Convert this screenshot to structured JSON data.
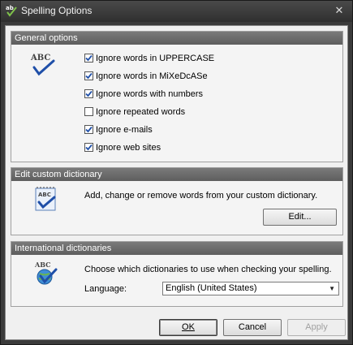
{
  "window": {
    "title": "Spelling Options",
    "app_icon": "abc-check-icon",
    "close_icon": "close-icon",
    "close_glyph": "✕"
  },
  "general": {
    "header": "General options",
    "icon": "abc-check-icon",
    "options": [
      {
        "label": "Ignore words in UPPERCASE",
        "checked": true
      },
      {
        "label": "Ignore words in MiXeDcASe",
        "checked": true
      },
      {
        "label": "Ignore words with numbers",
        "checked": true
      },
      {
        "label": "Ignore repeated words",
        "checked": false
      },
      {
        "label": "Ignore e-mails",
        "checked": true
      },
      {
        "label": "Ignore web sites",
        "checked": true
      }
    ]
  },
  "custom_dictionary": {
    "header": "Edit custom dictionary",
    "icon": "notepad-check-icon",
    "description": "Add, change or remove words from your custom dictionary.",
    "edit_button": "Edit..."
  },
  "international": {
    "header": "International dictionaries",
    "icon": "globe-check-icon",
    "description": "Choose which dictionaries to use when checking your spelling.",
    "language_label": "Language:",
    "language_value": "English (United States)"
  },
  "buttons": {
    "ok": "OK",
    "cancel": "Cancel",
    "apply": "Apply"
  },
  "colors": {
    "accent_blue": "#2e6db4",
    "check_blue": "#1f4fa8",
    "header_gray": "#6b6b6b"
  }
}
